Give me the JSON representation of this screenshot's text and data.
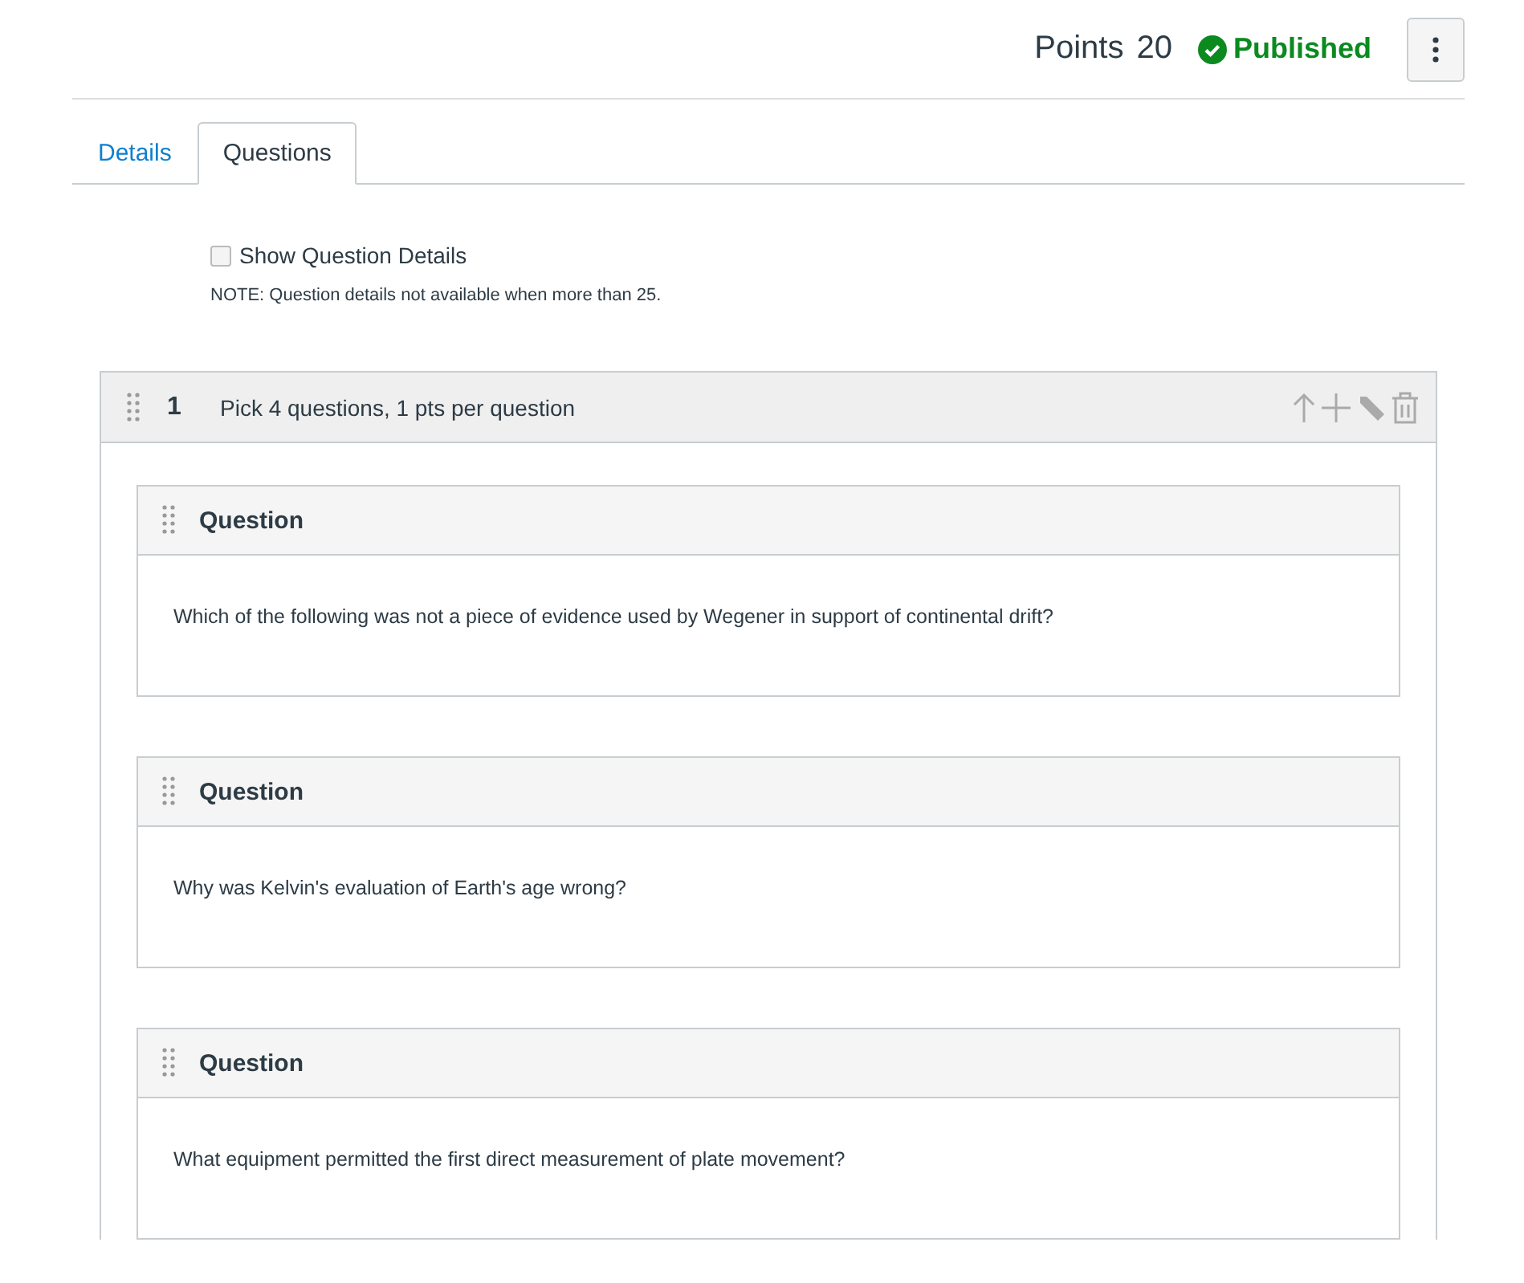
{
  "header": {
    "points_label": "Points",
    "points_value": "20",
    "status": "Published",
    "published": true
  },
  "tabs": [
    {
      "label": "Details",
      "selected": false
    },
    {
      "label": "Questions",
      "selected": true
    }
  ],
  "show_details": {
    "label": "Show Question Details",
    "checked": false,
    "note": "NOTE: Question details not available when more than 25."
  },
  "group": {
    "number": "1",
    "title": "Pick 4 questions, 1 pts per question",
    "questions": [
      {
        "title": "Question",
        "text": "Which of the following was not a piece of evidence used by Wegener in support of continental drift?"
      },
      {
        "title": "Question",
        "text": "Why was Kelvin's evaluation of Earth's age wrong?"
      },
      {
        "title": "Question",
        "text": "What equipment permitted the first direct measurement of plate movement?"
      }
    ]
  }
}
